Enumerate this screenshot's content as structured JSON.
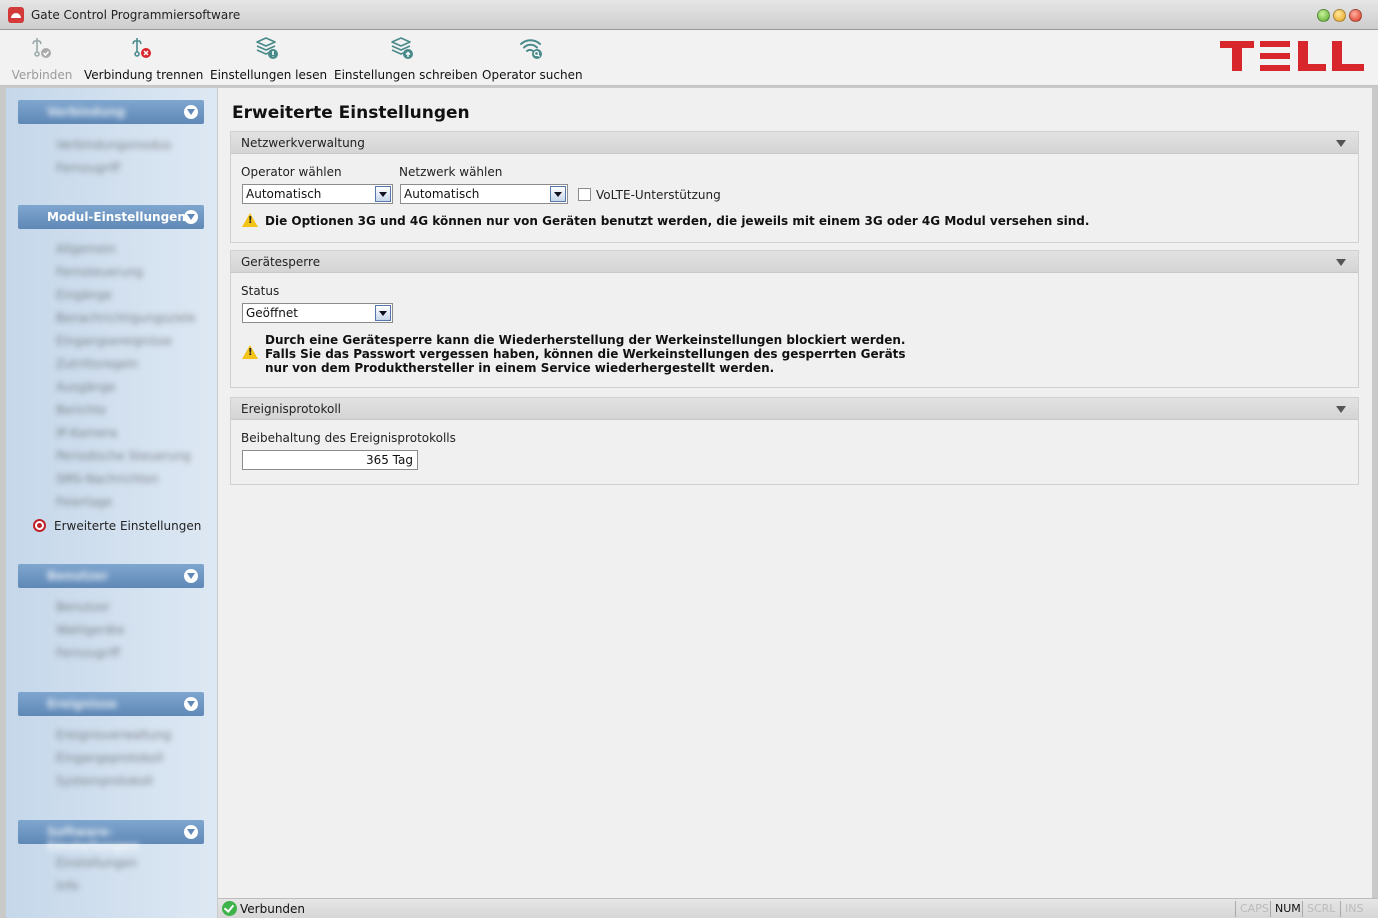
{
  "window": {
    "title": "Gate Control Programmiersoftware"
  },
  "toolbar": {
    "connect": "Verbinden",
    "disconnect": "Verbindung trennen",
    "read": "Einstellungen lesen",
    "write": "Einstellungen schreiben",
    "operator_search": "Operator suchen"
  },
  "brand": {
    "logo_text": "TELL",
    "color": "#d8262d"
  },
  "sidebar": {
    "sections": [
      {
        "label": "Verbindung",
        "blurred": true
      },
      {
        "label": "Modul-Einstellungen",
        "blurred": false
      },
      {
        "label": "Benutzer",
        "blurred": true
      },
      {
        "label": "Ereignisse",
        "blurred": true
      },
      {
        "label": "Software-Einstellungen",
        "blurred": true
      }
    ],
    "items_section1": [
      "Verbindungsmodus",
      "Fernzugriff"
    ],
    "items_section2": [
      "Allgemein",
      "Fernsteuerung",
      "Eingänge",
      "Benachrichtigungsziele",
      "Eingangsereignisse",
      "Zutrittsregeln",
      "Ausgänge",
      "Berichte",
      "IP-Kamera",
      "Periodische Steuerung",
      "SMS-Nachrichten",
      "Feiertage"
    ],
    "active_item": "Erweiterte Einstellungen",
    "items_section3": [
      "Benutzer",
      "Wahlgeräte",
      "Fernzugriff"
    ],
    "items_section4": [
      "Ereignisverwaltung",
      "Eingangsprotokoll",
      "Systemprotokoll"
    ],
    "items_section5": [
      "Einstellungen",
      "Info"
    ]
  },
  "page": {
    "title": "Erweiterte Einstellungen"
  },
  "network": {
    "header": "Netzwerkverwaltung",
    "operator_label": "Operator wählen",
    "operator_value": "Automatisch",
    "network_label": "Netzwerk wählen",
    "network_value": "Automatisch",
    "volte_label": "VoLTE-Unterstützung",
    "volte_checked": false,
    "warning": "Die Optionen 3G und 4G können nur von Geräten benutzt werden, die jeweils mit einem 3G oder 4G Modul versehen sind."
  },
  "lock": {
    "header": "Gerätesperre",
    "status_label": "Status",
    "status_value": "Geöffnet",
    "warning_line1": "Durch eine Gerätesperre kann die Wiederherstellung der Werkeinstellungen blockiert werden.",
    "warning_line2": "Falls Sie das Passwort vergessen haben, können die Werkeinstellungen des gesperrten Geräts",
    "warning_line3": "nur von dem Produkthersteller in einem Service wiederhergestellt werden."
  },
  "log": {
    "header": "Ereignisprotokoll",
    "retention_label": "Beibehaltung des Ereignisprotokolls",
    "retention_value": "365 Tag"
  },
  "statusbar": {
    "status": "Verbunden",
    "caps": "CAPS",
    "num": "NUM",
    "scrl": "SCRL",
    "ins": "INS"
  }
}
